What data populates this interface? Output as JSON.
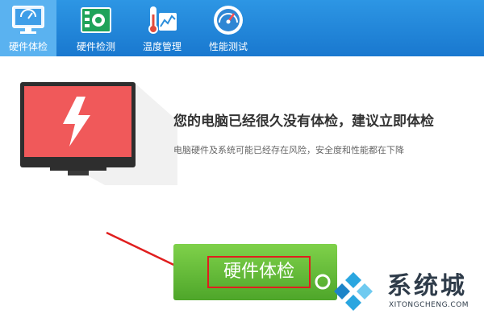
{
  "toolbar": {
    "tabs": [
      {
        "label": "硬件体检",
        "icon": "monitor-check-icon",
        "active": true
      },
      {
        "label": "硬件检测",
        "icon": "circuit-board-icon",
        "active": false
      },
      {
        "label": "温度管理",
        "icon": "thermometer-chart-icon",
        "active": false
      },
      {
        "label": "性能测试",
        "icon": "speedometer-icon",
        "active": false
      }
    ]
  },
  "main": {
    "headline": "您的电脑已经很久没有体检，建议立即体检",
    "subline": "电脑硬件及系统可能已经存在风险，安全度和性能都在下降",
    "check_button_label": "硬件体检",
    "illustration_icon": "lightning-monitor-icon"
  },
  "watermark": {
    "name": "系统城",
    "url": "XITONGCHENG.COM"
  },
  "colors": {
    "toolbar": "#1e82d6",
    "active_tab": "#5ab2f0",
    "screen": "#f0595a",
    "button": "#5fb535",
    "highlight": "#e01e1e"
  }
}
